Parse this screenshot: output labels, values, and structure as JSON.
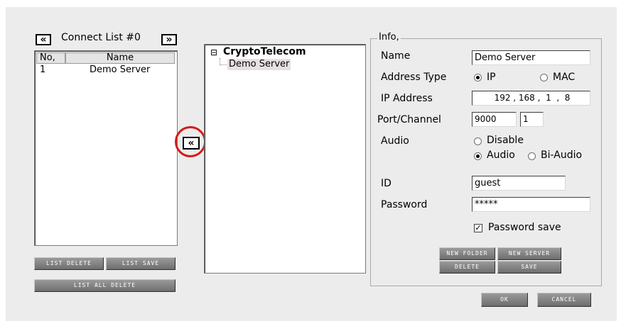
{
  "connect_list": {
    "title": "Connect List #0",
    "prev_glyph": "«",
    "next_glyph": "»",
    "columns": [
      "No,",
      "Name"
    ],
    "rows": [
      {
        "no": "1",
        "name": "Demo Server"
      }
    ],
    "buttons": {
      "list_delete": "LIST DELETE",
      "list_save": "LIST SAVE",
      "list_all_delete": "LIST ALL DELETE"
    }
  },
  "transfer_button": {
    "glyph": "«"
  },
  "tree": {
    "expander": "⊟",
    "root": "CryptoTelecom",
    "child": "Demo Server"
  },
  "info": {
    "legend": "Info,",
    "name_label": "Name",
    "name_value": "Demo Server",
    "address_type_label": "Address Type",
    "address_type_options": [
      "IP",
      "MAC"
    ],
    "address_type_selected": "IP",
    "ip_label": "IP Address",
    "ip_value": "192 , 168 ,  1  ,  8",
    "port_label": "Port/Channel",
    "port_value": "9000",
    "channel_value": "1",
    "audio_label": "Audio",
    "audio_options": [
      "Disable",
      "Audio",
      "Bi-Audio"
    ],
    "audio_selected": "Audio",
    "id_label": "ID",
    "id_value": "guest",
    "password_label": "Password",
    "password_value": "*****",
    "password_save_label": "Password save",
    "password_save_checked": true,
    "buttons": {
      "new_folder": "NEW FOLDER",
      "new_server": "NEW SERVER",
      "delete": "DELETE",
      "save": "SAVE"
    }
  },
  "dialog_buttons": {
    "ok": "OK",
    "cancel": "CANCEL"
  },
  "highlight_color": "#d61a1a"
}
